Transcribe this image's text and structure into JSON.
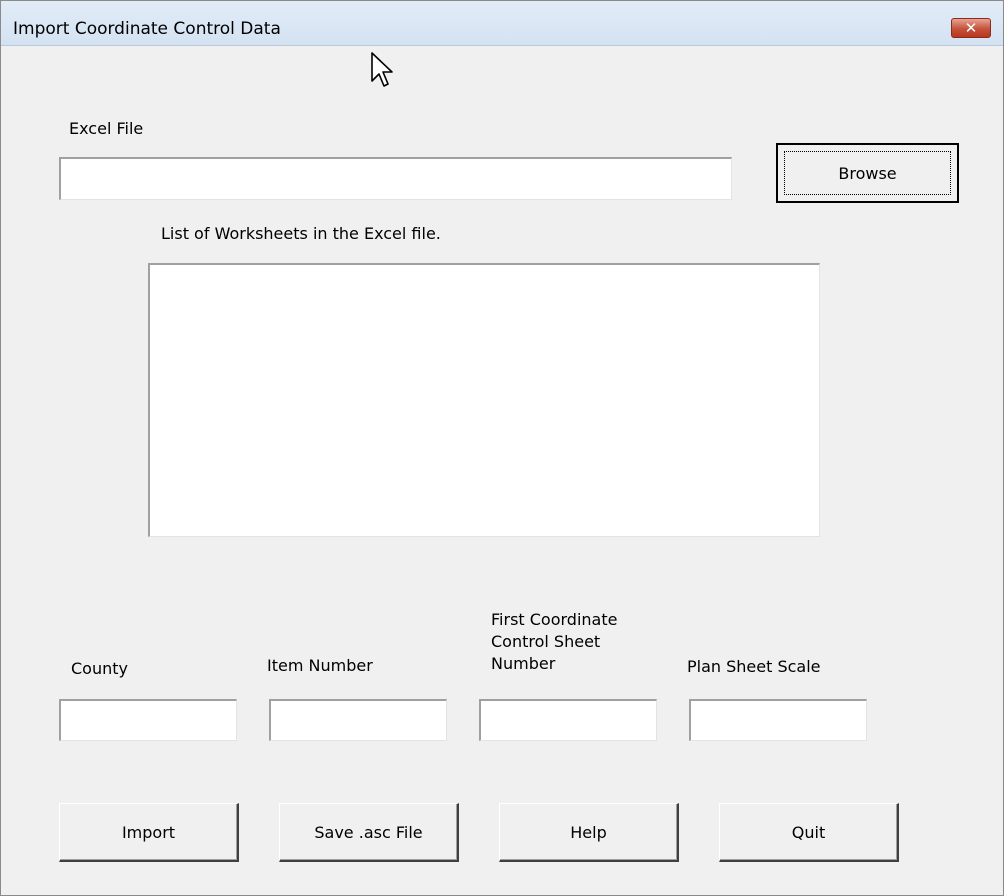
{
  "window": {
    "title": "Import Coordinate Control Data",
    "close_glyph": "✕"
  },
  "excel_file": {
    "label": "Excel File",
    "value": "",
    "browse_label": "Browse"
  },
  "worksheets": {
    "label": "List of Worksheets in the Excel file.",
    "items": []
  },
  "fields": {
    "county": {
      "label": "County",
      "value": ""
    },
    "item_number": {
      "label": "Item Number",
      "value": ""
    },
    "first_sheet": {
      "label": "First Coordinate Control Sheet Number",
      "value": ""
    },
    "plan_scale": {
      "label": "Plan Sheet Scale",
      "value": ""
    }
  },
  "buttons": {
    "import": "Import",
    "save_asc": "Save .asc File",
    "help": "Help",
    "quit": "Quit"
  },
  "colors": {
    "close_button": "#c65139",
    "titlebar": "#dae6f3",
    "dialog_bg": "#f0f0f0"
  }
}
